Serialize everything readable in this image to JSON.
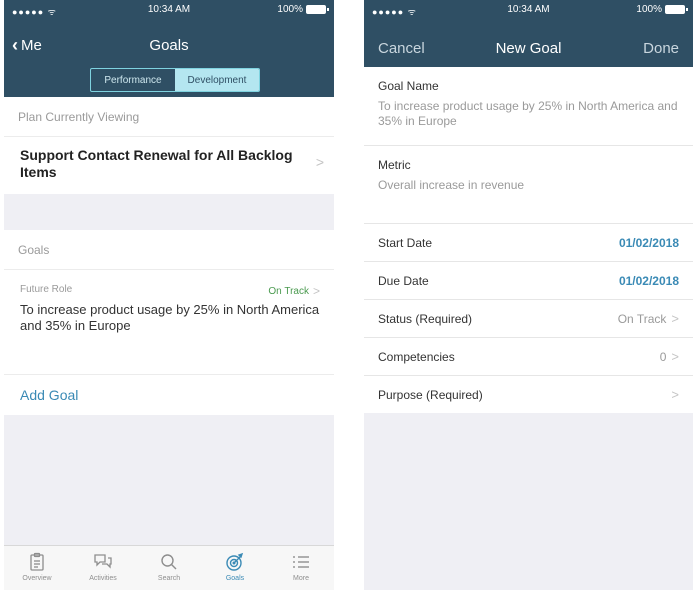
{
  "left": {
    "status": {
      "time": "10:34 AM",
      "battery": "100%"
    },
    "nav": {
      "back_label": "Me",
      "title": "Goals"
    },
    "segments": [
      "Performance",
      "Development"
    ],
    "plan_header": "Plan Currently Viewing",
    "plan_title": "Support Contact Renewal for All Backlog Items",
    "goals_header": "Goals",
    "goal": {
      "role": "Future Role",
      "status": "On Track",
      "text": "To increase product usage by 25% in North America and 35% in Europe"
    },
    "add_goal": "Add Goal",
    "tabs": [
      {
        "label": "Overview",
        "icon": "clipboard-icon"
      },
      {
        "label": "Activities",
        "icon": "chat-bubbles-icon"
      },
      {
        "label": "Search",
        "icon": "search-icon"
      },
      {
        "label": "Goals",
        "icon": "target-icon"
      },
      {
        "label": "More",
        "icon": "more-list-icon"
      }
    ],
    "active_tab": "Goals"
  },
  "right": {
    "status": {
      "time": "10:34 AM",
      "battery": "100%"
    },
    "nav": {
      "cancel": "Cancel",
      "title": "New Goal",
      "done": "Done"
    },
    "goal_name": {
      "label": "Goal Name",
      "value": "To increase product usage by 25% in North America and 35% in Europe"
    },
    "metric": {
      "label": "Metric",
      "value": "Overall increase in revenue"
    },
    "rows": [
      {
        "label": "Start Date",
        "value": "01/02/2018"
      },
      {
        "label": "Due Date",
        "value": "01/02/2018"
      },
      {
        "label": "Status (Required)",
        "value": "On Track"
      },
      {
        "label": "Competencies",
        "value": "0"
      },
      {
        "label": "Purpose (Required)",
        "value": ""
      }
    ]
  },
  "colors": {
    "nav_bg": "#2f4f64",
    "accent": "#3a8ab5",
    "segment_active": "#b4e6f0",
    "on_track": "#4a9a4f"
  }
}
